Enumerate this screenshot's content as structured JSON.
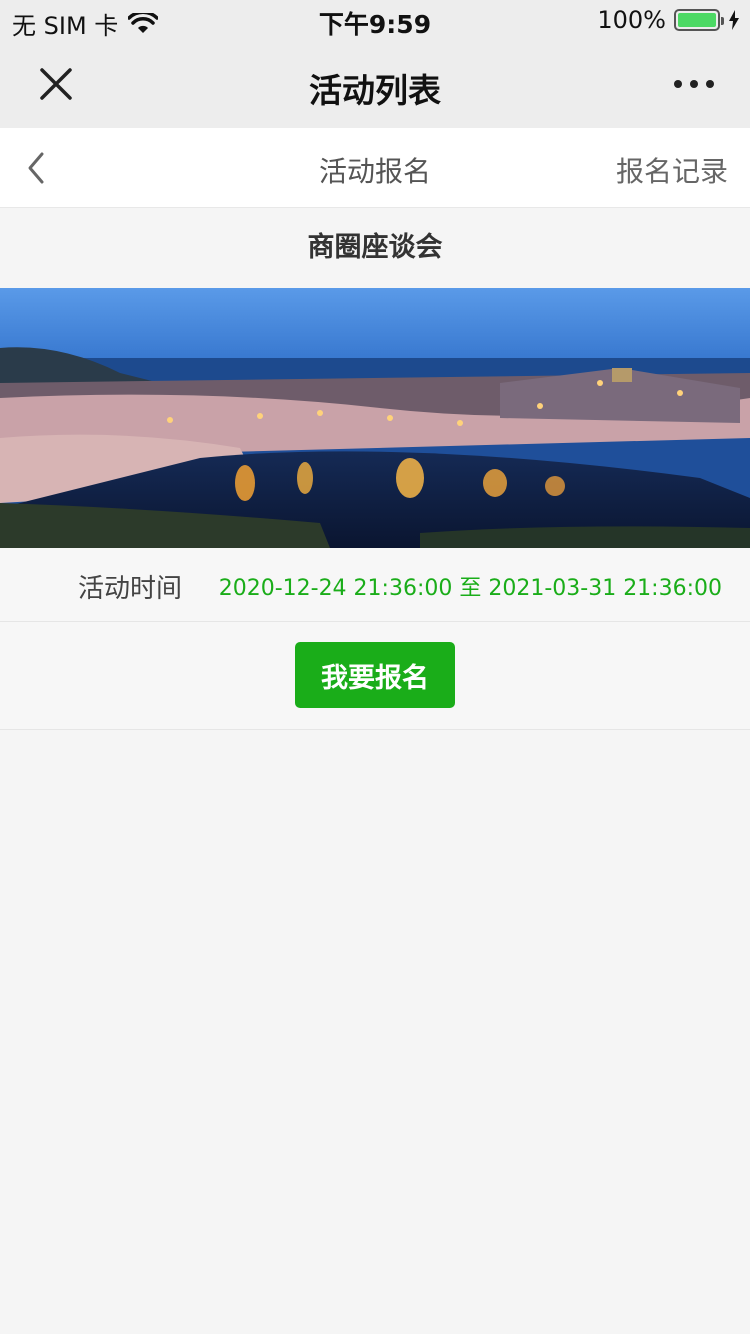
{
  "status_bar": {
    "carrier": "无 SIM 卡",
    "time": "下午9:59",
    "battery": "100%",
    "battery_level": 1.0
  },
  "nav": {
    "title": "活动列表",
    "close_icon": "close-icon",
    "more_icon": "more-icon"
  },
  "sub_header": {
    "title": "活动报名",
    "record_label": "报名记录",
    "back_icon": "chevron-left-icon"
  },
  "event": {
    "title": "商圈座谈会",
    "time_label": "活动时间",
    "time_value": "2020-12-24 21:36:00 至 2021-03-31 21:36:00",
    "signup_label": "我要报名"
  },
  "colors": {
    "accent": "#1aad19",
    "background": "#f5f5f5",
    "nav_background": "#ededed"
  }
}
